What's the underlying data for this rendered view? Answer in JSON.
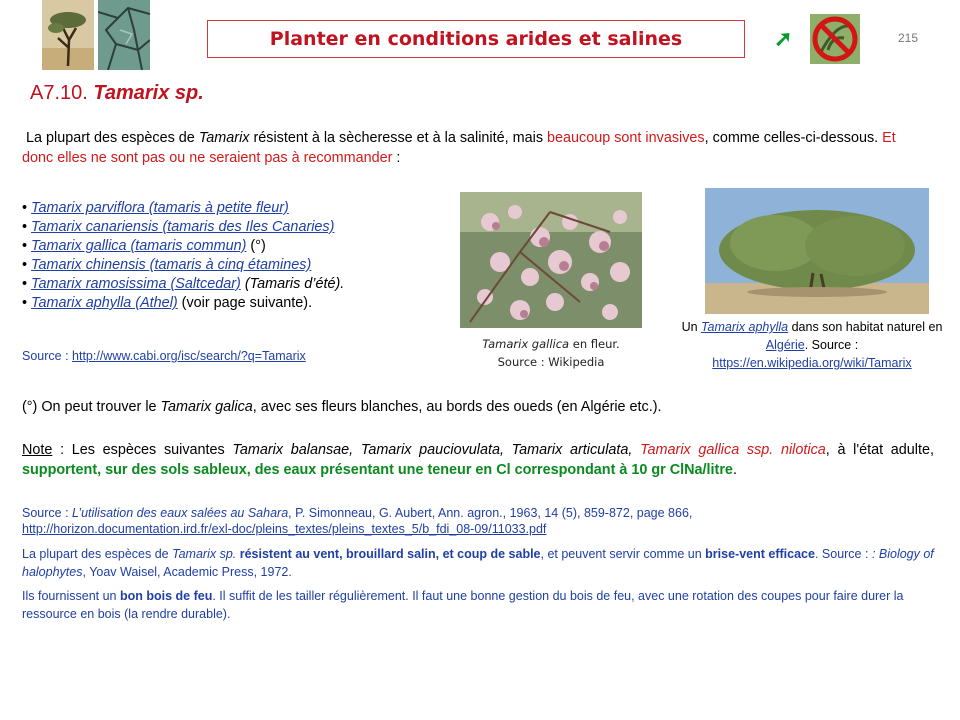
{
  "header": {
    "title": "Planter en conditions arides et salines",
    "page_number": "215",
    "arrow_glyph": "➚"
  },
  "section": {
    "number": "A7.10.",
    "name": "Tamarix sp."
  },
  "intro": {
    "t1": "La plupart des espèces de ",
    "t2": "Tamarix",
    "t3": " résistent à la sècheresse et à la salinité, mais ",
    "t4": "beaucoup sont invasives",
    "t5": ", comme celles-ci-dessous. ",
    "t6": "Et donc elles ne sont pas ou ne seraient pas à recommander",
    "t7": " :"
  },
  "species": [
    {
      "bullet": "•",
      "link": "Tamarix parviflora (tamaris à petite fleur)",
      "rest": ""
    },
    {
      "bullet": "•",
      "link": "Tamarix canariensis (tamaris des Iles Canaries)",
      "rest": ""
    },
    {
      "bullet": "•",
      "link": "Tamarix gallica (tamaris commun)",
      "rest": " (°)"
    },
    {
      "bullet": "•",
      "link": "Tamarix chinensis (tamaris à cinq étamines)",
      "rest": ""
    },
    {
      "bullet": "•",
      "link": "Tamarix ramosissima (Saltcedar)",
      "rest": " (Tamaris d’été)."
    },
    {
      "bullet": "•",
      "link": "Tamarix aphylla (Athel)",
      "rest": " (voir page suivante)."
    }
  ],
  "source_cabi": {
    "label": "Source : ",
    "url": "http://www.cabi.org/isc/search/?q=Tamarix"
  },
  "image1": {
    "caption_italic": "Tamarix gallica",
    "caption_rest": " en fleur.",
    "caption_source": "Source : Wikipedia"
  },
  "image2": {
    "c1": "Un ",
    "c2": "Tamarix aphylla",
    "c3": "  dans son habitat naturel en ",
    "c4": "Algérie",
    "c5": ". Source : ",
    "c6": "https://en.wikipedia.org/wiki/Tamarix"
  },
  "note1": {
    "a": "(°) On peut trouver le ",
    "b": "Tamarix galica",
    "c": ", avec ses fleurs blanches, au bords des oueds (en Algérie etc.)."
  },
  "note2": {
    "label": "Note",
    "a": " : Les espèces suivantes ",
    "b": "Tamarix balansae, Tamarix pauciovulata, Tamarix articulata, ",
    "c": "Tamarix gallica ssp. nilotica",
    "d": ", à l'état adulte, ",
    "e": "supportent, sur des sols sableux, des eaux présentant une teneur en Cl correspondant à 10 gr ClNa/litre",
    "f": "."
  },
  "source2": {
    "a": "Source : ",
    "b": "L’utilisation des eaux salées au Sahara",
    "c": ", P. Simonneau, G. Aubert, Ann. agron., 1963, 14 (5), 859-872, page 866,",
    "url": "http://horizon.documentation.ird.fr/exl-doc/pleins_textes/pleins_textes_5/b_fdi_08-09/11033.pdf"
  },
  "para3": {
    "a": "La plupart des espèces de ",
    "b": "Tamarix sp.",
    "c": " résistent au vent, brouillard salin, et coup de sable",
    "d": ", et peuvent servir comme un ",
    "e": "brise-vent efficace",
    "f": ". Source : ",
    "g": ": Biology of halophytes",
    "h": ", Yoav Waisel, Academic Press, 1972."
  },
  "para4": {
    "a": "Ils fournissent un ",
    "b": "bon bois de feu",
    "c": ". Il suffit de les tailler régulièrement. Il faut une bonne gestion du bois de feu, avec une rotation des coupes pour faire durer la ressource en bois (la rendre durable)."
  },
  "icons": [
    "desert-tree-icon",
    "cracked-soil-icon",
    "arrow-icon",
    "no-invasive-plant-icon"
  ],
  "colors": {
    "red": "#d21a1a",
    "green": "#0a8a1f",
    "link": "#1f3fa6",
    "title": "#c1121f"
  }
}
